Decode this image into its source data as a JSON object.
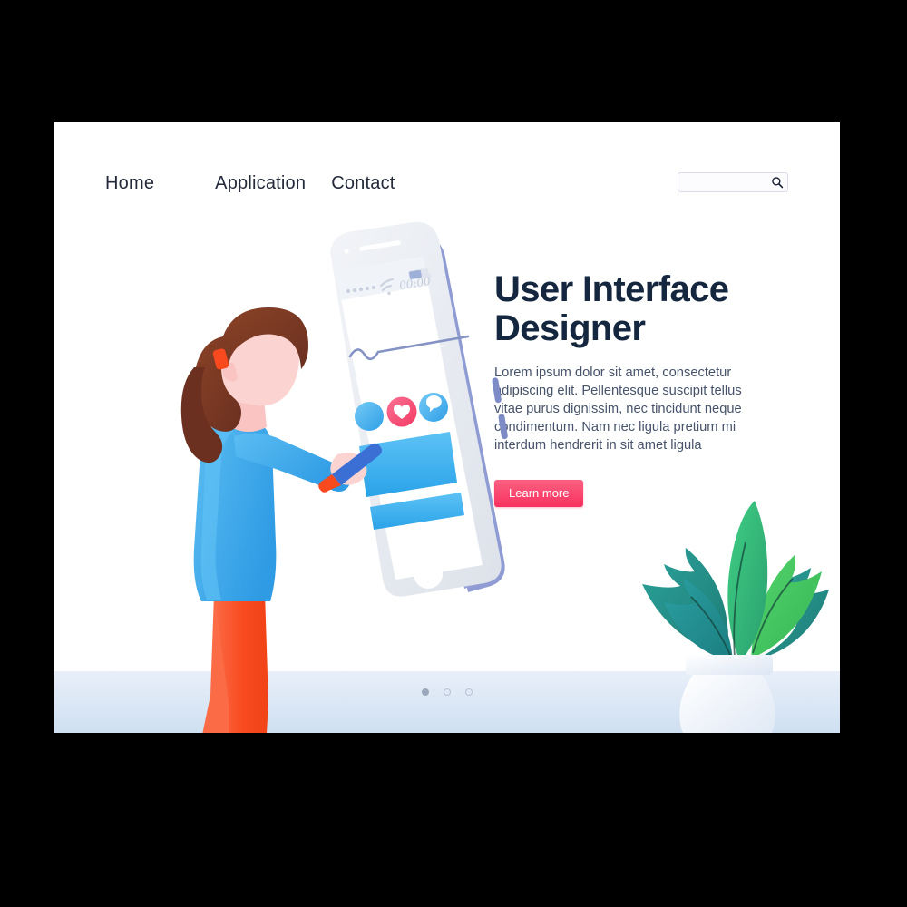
{
  "page": {
    "background_color": "#000000",
    "card_background": "#ffffff"
  },
  "nav": {
    "items": [
      {
        "label": "Home"
      },
      {
        "label": "Application"
      },
      {
        "label": "Contact"
      }
    ]
  },
  "search": {
    "value": "",
    "placeholder": "",
    "icon": "search-icon"
  },
  "hero": {
    "title": "User Interface Designer",
    "body": "Lorem ipsum dolor sit amet, consectetur adipiscing elit. Pellentesque suscipit tellus vitae purus dignissim, nec tincidunt neque condimentum. Nam nec ligula pretium mi interdum hendrerit in sit amet ligula",
    "cta_label": "Learn more",
    "title_color": "#15263f",
    "body_color": "#46536b",
    "cta_color": "#f9315f"
  },
  "carousel": {
    "dots": [
      {
        "active": true
      },
      {
        "active": false
      },
      {
        "active": false
      }
    ]
  },
  "illustration": {
    "phone": {
      "status_bar": {
        "time": "00:00",
        "signal_dots": 5,
        "wifi_icon": "wifi-icon",
        "battery_icon": "battery-icon"
      },
      "app_icons": [
        {
          "name": "circle-icon",
          "color": "#29a3e8"
        },
        {
          "name": "heart-icon",
          "color": "#f4486d"
        },
        {
          "name": "chat-bubble-icon",
          "color": "#29a3e8"
        }
      ],
      "content_blocks": [
        {
          "name": "content-block-large",
          "color": "#3aaeef"
        },
        {
          "name": "content-block-small",
          "color": "#3aaeef"
        }
      ],
      "body_color": "#e8ebf0",
      "edge_color": "#8f9cd4",
      "home_button_color": "#ffffff"
    },
    "person": {
      "hair_color": "#7a3a25",
      "skin_color": "#fbd3d1",
      "shirt_color": "#3aa8ea",
      "pants_color": "#f8491f",
      "shoe_color": "#3aa8ea",
      "hair_tie_color": "#f8491f",
      "pen_color": "#3b6fd4"
    },
    "plant": {
      "leaf_colors": [
        "#1f7a75",
        "#2aa17f",
        "#45c койне",
        "#3fbf6b",
        "#2e9e92"
      ],
      "pot_color": "#eef3fa"
    },
    "ground_color": "#cfe0f2"
  }
}
